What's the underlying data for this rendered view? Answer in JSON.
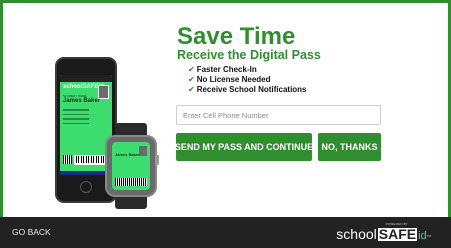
{
  "hero": {
    "title": "Save Time",
    "subtitle": "Receive the Digital Pass",
    "benefits": [
      "Faster Check-In",
      "No License Needed",
      "Receive School Notifications"
    ],
    "check_glyph": "✔"
  },
  "form": {
    "phone_placeholder": "Enter Cell Phone Number",
    "phone_value": "",
    "send_label": "SEND MY PASS AND CONTINUE",
    "decline_label": "NO, THANKS"
  },
  "pass_preview": {
    "app_logo": "schoolSAFEid",
    "name_label": "STUDENT NAME",
    "name": "James Baker"
  },
  "footer": {
    "back_label": "GO BACK",
    "powered_by": "POWERED BY",
    "brand_school": "school",
    "brand_safe": "SAFE",
    "brand_id": "id",
    "brand_tm": "TM"
  },
  "colors": {
    "accent": "#2f8f2f",
    "pass_green": "#3ddc6e",
    "footer_bg": "#222222",
    "frame_border": "#2f8f2f"
  }
}
